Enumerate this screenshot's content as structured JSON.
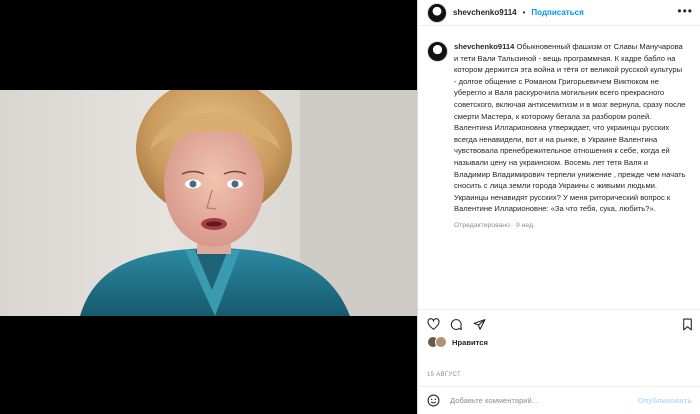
{
  "post": {
    "username": "shevchenko9114",
    "separator": "•",
    "follow_label": "Подписаться",
    "more_label": "•••",
    "caption_user": "shevchenko9114",
    "caption_text": "Обыкновенный фашизм от Славы Манучарова и тети Вали Талызиной - вещь программная. К кадре бабло на котором держится эта война и тётя от великой русской культуры - долгое общение с Романом Григорьевичем Виктюком не уберегло и Валя раскурочила могильник всего прекрасного советского, включая антисемитизм и в мозг вернула, сразу после смерти Мастера, к которому бегала за разбором ролей. Валентина Илларионовна утверждает, что украинцы русских всегда ненавидели, вот и на рынке, в Украине Валентина чувствовала пренебрежительное отношения к себе, когда ей называли цену на украинском. Восемь лет тетя Валя и Владимир Владимирович терпели унижение , прежде чем начать сносить с лица земли города Украины с живыми людьми. Украинцы ненавидят русских? У меня риторический вопрос к Валентине Илларионовне: «За что тебя, сука, любить?».",
    "edited_meta": "Отредактировано · 9 нед.",
    "likes_label": "Нравится",
    "date": "15 АВГУСТ",
    "comment_placeholder": "Добавьте комментарий...",
    "publish_label": "Опубликовать"
  },
  "icons": {
    "like": "heart-icon",
    "comment": "comment-icon",
    "share": "send-icon",
    "save": "bookmark-icon",
    "emoji": "smiley-icon"
  },
  "colors": {
    "accent": "#0095f6",
    "publish_disabled": "#b2dffc",
    "muted": "#8e8e8e",
    "jacket": "#1f6f86"
  }
}
